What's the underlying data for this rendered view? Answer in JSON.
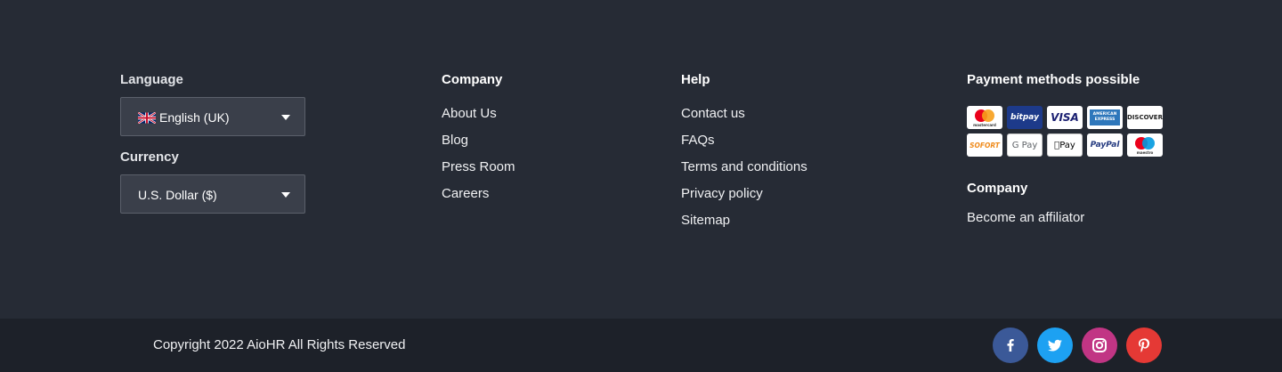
{
  "language": {
    "label": "Language",
    "selected": "English (UK)",
    "flag_icon": "uk-flag-icon"
  },
  "currency": {
    "label": "Currency",
    "selected": "U.S. Dollar ($)"
  },
  "company_col": {
    "title": "Company",
    "links": [
      "About Us",
      "Blog",
      "Press Room",
      "Careers"
    ]
  },
  "help_col": {
    "title": "Help",
    "links": [
      "Contact us",
      "FAQs",
      "Terms and conditions",
      "Privacy policy",
      "Sitemap"
    ]
  },
  "payment": {
    "title": "Payment methods possible",
    "methods": [
      {
        "name": "mastercard",
        "label": "mastercard"
      },
      {
        "name": "bitpay",
        "label": "bitpay"
      },
      {
        "name": "visa",
        "label": "VISA"
      },
      {
        "name": "american-express",
        "label": "AMERICAN EXPRESS"
      },
      {
        "name": "discover",
        "label": "DISCOVER"
      },
      {
        "name": "sofort",
        "label": "SOFORT"
      },
      {
        "name": "google-pay",
        "label": "G Pay"
      },
      {
        "name": "apple-pay",
        "label": "Pay"
      },
      {
        "name": "paypal",
        "label": "PayPal"
      },
      {
        "name": "maestro",
        "label": "maestro"
      }
    ]
  },
  "company_col2": {
    "title": "Company",
    "links": [
      "Become an affiliator"
    ]
  },
  "footer": {
    "copyright": "Copyright 2022 AioHR All Rights Reserved"
  },
  "social": [
    {
      "name": "facebook-icon",
      "color": "#3b5998"
    },
    {
      "name": "twitter-icon",
      "color": "#1da1f2"
    },
    {
      "name": "instagram-icon",
      "color": "#c13584"
    },
    {
      "name": "pinterest-icon",
      "color": "#e53935"
    }
  ]
}
